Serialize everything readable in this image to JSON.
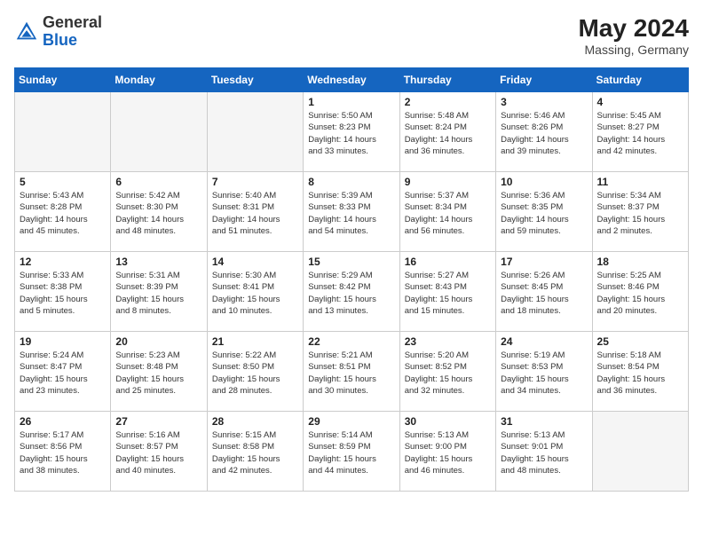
{
  "header": {
    "logo_general": "General",
    "logo_blue": "Blue",
    "month_year": "May 2024",
    "location": "Massing, Germany"
  },
  "weekdays": [
    "Sunday",
    "Monday",
    "Tuesday",
    "Wednesday",
    "Thursday",
    "Friday",
    "Saturday"
  ],
  "weeks": [
    [
      {
        "num": "",
        "info": "",
        "empty": true
      },
      {
        "num": "",
        "info": "",
        "empty": true
      },
      {
        "num": "",
        "info": "",
        "empty": true
      },
      {
        "num": "1",
        "info": "Sunrise: 5:50 AM\nSunset: 8:23 PM\nDaylight: 14 hours\nand 33 minutes."
      },
      {
        "num": "2",
        "info": "Sunrise: 5:48 AM\nSunset: 8:24 PM\nDaylight: 14 hours\nand 36 minutes."
      },
      {
        "num": "3",
        "info": "Sunrise: 5:46 AM\nSunset: 8:26 PM\nDaylight: 14 hours\nand 39 minutes."
      },
      {
        "num": "4",
        "info": "Sunrise: 5:45 AM\nSunset: 8:27 PM\nDaylight: 14 hours\nand 42 minutes."
      }
    ],
    [
      {
        "num": "5",
        "info": "Sunrise: 5:43 AM\nSunset: 8:28 PM\nDaylight: 14 hours\nand 45 minutes."
      },
      {
        "num": "6",
        "info": "Sunrise: 5:42 AM\nSunset: 8:30 PM\nDaylight: 14 hours\nand 48 minutes."
      },
      {
        "num": "7",
        "info": "Sunrise: 5:40 AM\nSunset: 8:31 PM\nDaylight: 14 hours\nand 51 minutes."
      },
      {
        "num": "8",
        "info": "Sunrise: 5:39 AM\nSunset: 8:33 PM\nDaylight: 14 hours\nand 54 minutes."
      },
      {
        "num": "9",
        "info": "Sunrise: 5:37 AM\nSunset: 8:34 PM\nDaylight: 14 hours\nand 56 minutes."
      },
      {
        "num": "10",
        "info": "Sunrise: 5:36 AM\nSunset: 8:35 PM\nDaylight: 14 hours\nand 59 minutes."
      },
      {
        "num": "11",
        "info": "Sunrise: 5:34 AM\nSunset: 8:37 PM\nDaylight: 15 hours\nand 2 minutes."
      }
    ],
    [
      {
        "num": "12",
        "info": "Sunrise: 5:33 AM\nSunset: 8:38 PM\nDaylight: 15 hours\nand 5 minutes."
      },
      {
        "num": "13",
        "info": "Sunrise: 5:31 AM\nSunset: 8:39 PM\nDaylight: 15 hours\nand 8 minutes."
      },
      {
        "num": "14",
        "info": "Sunrise: 5:30 AM\nSunset: 8:41 PM\nDaylight: 15 hours\nand 10 minutes."
      },
      {
        "num": "15",
        "info": "Sunrise: 5:29 AM\nSunset: 8:42 PM\nDaylight: 15 hours\nand 13 minutes."
      },
      {
        "num": "16",
        "info": "Sunrise: 5:27 AM\nSunset: 8:43 PM\nDaylight: 15 hours\nand 15 minutes."
      },
      {
        "num": "17",
        "info": "Sunrise: 5:26 AM\nSunset: 8:45 PM\nDaylight: 15 hours\nand 18 minutes."
      },
      {
        "num": "18",
        "info": "Sunrise: 5:25 AM\nSunset: 8:46 PM\nDaylight: 15 hours\nand 20 minutes."
      }
    ],
    [
      {
        "num": "19",
        "info": "Sunrise: 5:24 AM\nSunset: 8:47 PM\nDaylight: 15 hours\nand 23 minutes."
      },
      {
        "num": "20",
        "info": "Sunrise: 5:23 AM\nSunset: 8:48 PM\nDaylight: 15 hours\nand 25 minutes."
      },
      {
        "num": "21",
        "info": "Sunrise: 5:22 AM\nSunset: 8:50 PM\nDaylight: 15 hours\nand 28 minutes."
      },
      {
        "num": "22",
        "info": "Sunrise: 5:21 AM\nSunset: 8:51 PM\nDaylight: 15 hours\nand 30 minutes."
      },
      {
        "num": "23",
        "info": "Sunrise: 5:20 AM\nSunset: 8:52 PM\nDaylight: 15 hours\nand 32 minutes."
      },
      {
        "num": "24",
        "info": "Sunrise: 5:19 AM\nSunset: 8:53 PM\nDaylight: 15 hours\nand 34 minutes."
      },
      {
        "num": "25",
        "info": "Sunrise: 5:18 AM\nSunset: 8:54 PM\nDaylight: 15 hours\nand 36 minutes."
      }
    ],
    [
      {
        "num": "26",
        "info": "Sunrise: 5:17 AM\nSunset: 8:56 PM\nDaylight: 15 hours\nand 38 minutes."
      },
      {
        "num": "27",
        "info": "Sunrise: 5:16 AM\nSunset: 8:57 PM\nDaylight: 15 hours\nand 40 minutes."
      },
      {
        "num": "28",
        "info": "Sunrise: 5:15 AM\nSunset: 8:58 PM\nDaylight: 15 hours\nand 42 minutes."
      },
      {
        "num": "29",
        "info": "Sunrise: 5:14 AM\nSunset: 8:59 PM\nDaylight: 15 hours\nand 44 minutes."
      },
      {
        "num": "30",
        "info": "Sunrise: 5:13 AM\nSunset: 9:00 PM\nDaylight: 15 hours\nand 46 minutes."
      },
      {
        "num": "31",
        "info": "Sunrise: 5:13 AM\nSunset: 9:01 PM\nDaylight: 15 hours\nand 48 minutes."
      },
      {
        "num": "",
        "info": "",
        "empty": true
      }
    ]
  ]
}
